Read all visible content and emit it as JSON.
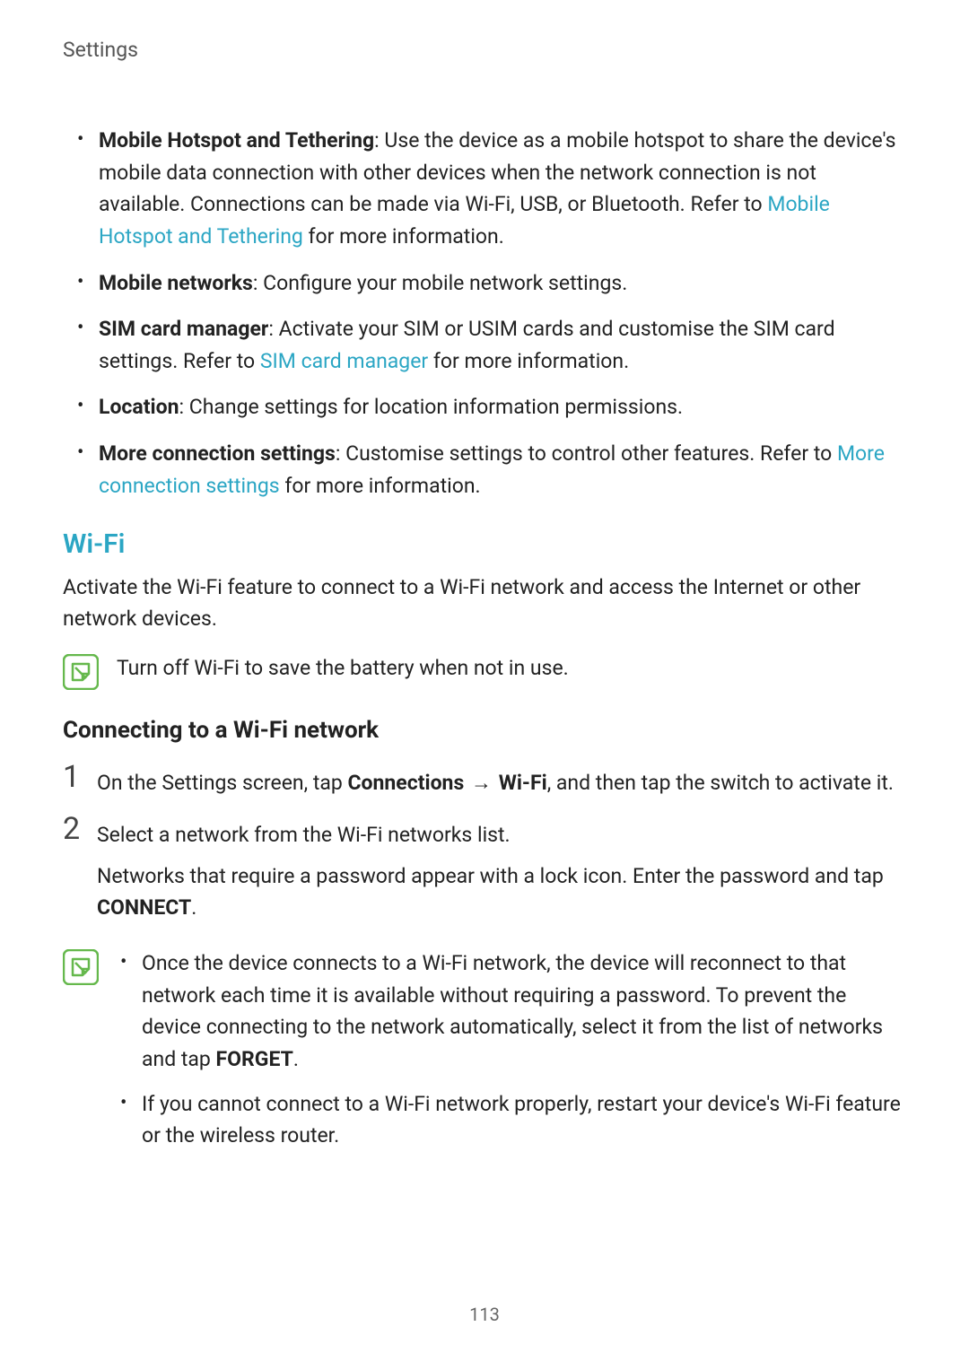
{
  "breadcrumb": "Settings",
  "bullets": [
    {
      "bold": "Mobile Hotspot and Tethering",
      "text": ": Use the device as a mobile hotspot to share the device's mobile data connection with other devices when the network connection is not available. Connections can be made via Wi-Fi, USB, or Bluetooth. Refer to ",
      "link": "Mobile Hotspot and Tethering",
      "tail": " for more information."
    },
    {
      "bold": "Mobile networks",
      "text": ": Configure your mobile network settings.",
      "link": "",
      "tail": ""
    },
    {
      "bold": "SIM card manager",
      "text": ": Activate your SIM or USIM cards and customise the SIM card settings. Refer to ",
      "link": "SIM card manager",
      "tail": " for more information."
    },
    {
      "bold": "Location",
      "text": ": Change settings for location information permissions.",
      "link": "",
      "tail": ""
    },
    {
      "bold": "More connection settings",
      "text": ": Customise settings to control other features. Refer to ",
      "link": "More connection settings",
      "tail": " for more information."
    }
  ],
  "section_title": "Wi-Fi",
  "section_intro": "Activate the Wi-Fi feature to connect to a Wi-Fi network and access the Internet or other network devices.",
  "note1": "Turn off Wi-Fi to save the battery when not in use.",
  "subsection_title": "Connecting to a Wi-Fi network",
  "step1": {
    "num": "1",
    "pre": "On the Settings screen, tap ",
    "b1": "Connections",
    "arrow": " → ",
    "b2": "Wi-Fi",
    "post": ", and then tap the switch to activate it."
  },
  "step2": {
    "num": "2",
    "line1": "Select a network from the Wi-Fi networks list.",
    "line2_pre": "Networks that require a password appear with a lock icon. Enter the password and tap ",
    "line2_bold": "CONNECT",
    "line2_post": "."
  },
  "note2": {
    "item1_pre": "Once the device connects to a Wi-Fi network, the device will reconnect to that network each time it is available without requiring a password. To prevent the device connecting to the network automatically, select it from the list of networks and tap ",
    "item1_bold": "FORGET",
    "item1_post": ".",
    "item2": "If you cannot connect to a Wi-Fi network properly, restart your device's Wi-Fi feature or the wireless router."
  },
  "page_number": "113"
}
